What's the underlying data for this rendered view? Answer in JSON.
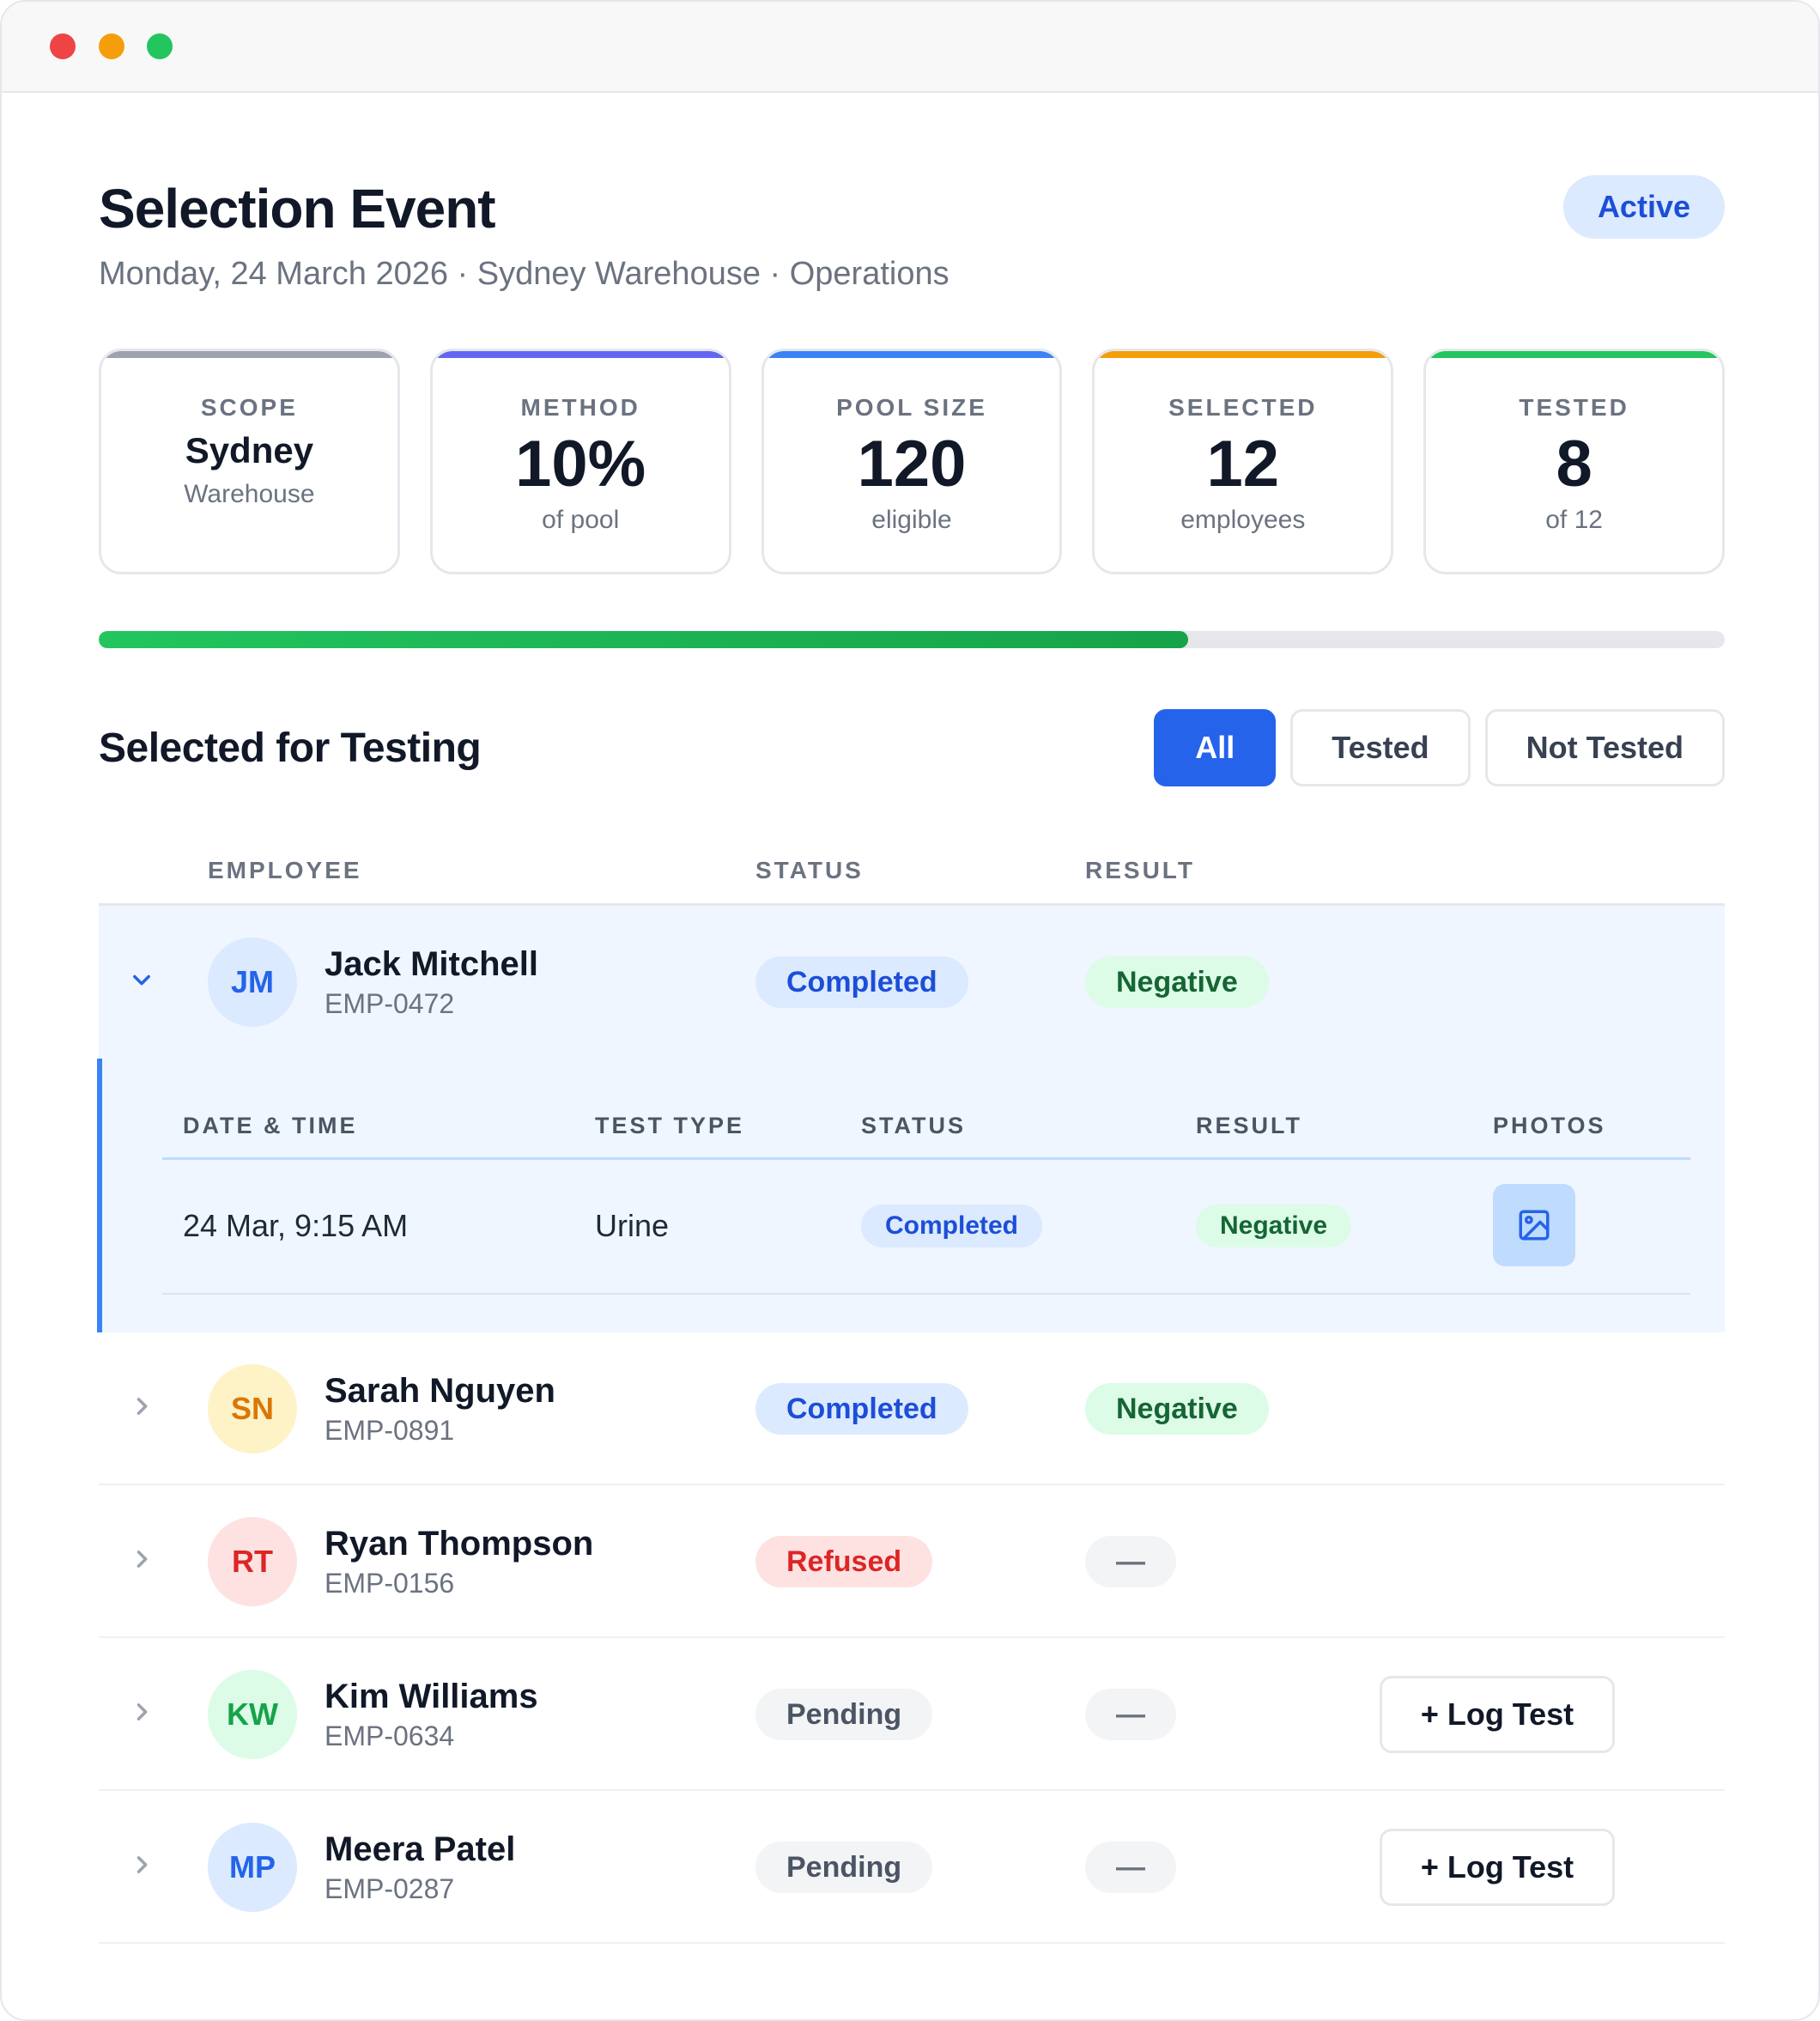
{
  "header": {
    "title": "Selection Event",
    "subtitle": "Monday, 24 March 2026 · Sydney Warehouse · Operations",
    "status": "Active"
  },
  "stats": [
    {
      "label": "SCOPE",
      "value": "Sydney",
      "sub": "Warehouse",
      "accent": "#9ca3af"
    },
    {
      "label": "METHOD",
      "value": "10%",
      "sub": "of pool",
      "accent": "#6366f1"
    },
    {
      "label": "POOL SIZE",
      "value": "120",
      "sub": "eligible",
      "accent": "#3b82f6"
    },
    {
      "label": "SELECTED",
      "value": "12",
      "sub": "employees",
      "accent": "#f59e0b"
    },
    {
      "label": "TESTED",
      "value": "8",
      "sub": "of 12",
      "accent": "#22c55e"
    }
  ],
  "progress": {
    "fraction": 0.67
  },
  "section": {
    "title": "Selected for Testing",
    "filters": [
      {
        "label": "All",
        "active": true
      },
      {
        "label": "Tested",
        "active": false
      },
      {
        "label": "Not Tested",
        "active": false
      }
    ]
  },
  "table": {
    "columns": {
      "employee": "EMPLOYEE",
      "status": "STATUS",
      "result": "RESULT"
    },
    "rows": [
      {
        "initials": "JM",
        "name": "Jack Mitchell",
        "id": "EMP-0472",
        "status": "Completed",
        "result": "Negative",
        "avatar_bg": "#dbeafe",
        "avatar_fg": "#2563eb"
      },
      {
        "initials": "SN",
        "name": "Sarah Nguyen",
        "id": "EMP-0891",
        "status": "Completed",
        "result": "Negative",
        "avatar_bg": "#fef3c7",
        "avatar_fg": "#d97706"
      },
      {
        "initials": "RT",
        "name": "Ryan Thompson",
        "id": "EMP-0156",
        "status": "Refused",
        "result": "—",
        "avatar_bg": "#fee2e2",
        "avatar_fg": "#dc2626"
      },
      {
        "initials": "KW",
        "name": "Kim Williams",
        "id": "EMP-0634",
        "status": "Pending",
        "result": "—",
        "action": "+ Log Test",
        "avatar_bg": "#dcfce7",
        "avatar_fg": "#16a34a"
      },
      {
        "initials": "MP",
        "name": "Meera Patel",
        "id": "EMP-0287",
        "status": "Pending",
        "result": "—",
        "action": "+ Log Test",
        "avatar_bg": "#dbeafe",
        "avatar_fg": "#2563eb"
      }
    ]
  },
  "detail": {
    "columns": {
      "datetime": "DATE & TIME",
      "type": "TEST TYPE",
      "status": "STATUS",
      "result": "RESULT",
      "photos": "PHOTOS"
    },
    "row": {
      "datetime": "24 Mar, 9:15 AM",
      "type": "Urine",
      "status": "Completed",
      "result": "Negative",
      "photo_icon": "image-icon"
    }
  }
}
